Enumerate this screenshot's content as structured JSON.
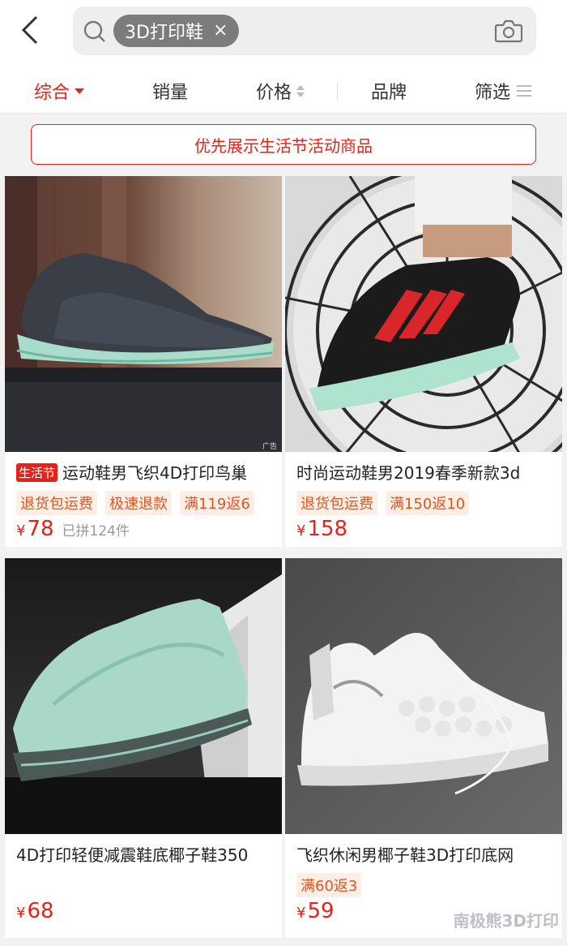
{
  "search": {
    "chip_text": "3D打印鞋",
    "chip_close": "×"
  },
  "sort": {
    "items": [
      "综合",
      "销量",
      "价格",
      "品牌",
      "筛选"
    ],
    "active": "综合"
  },
  "promo": {
    "text": "优先展示生活节活动商品"
  },
  "products": [
    {
      "badge": "生活节",
      "title": "运动鞋男飞织4D打印鸟巢",
      "tags": [
        "退货包运费",
        "极速退款",
        "满119返6"
      ],
      "currency": "¥",
      "price": "78",
      "sold": "已拼124件",
      "ad_label": "广告",
      "image": "dark-gray-knit-sneaker-teal-sole"
    },
    {
      "title": "时尚运动鞋男2019春季新款3d",
      "tags": [
        "退货包运费",
        "满150返10"
      ],
      "currency": "¥",
      "price": "158",
      "image": "black-red-sneaker-fan-background"
    },
    {
      "title": "4D打印轻便减震鞋底椰子鞋350",
      "tags": [],
      "currency": "¥",
      "price": "68",
      "image": "mint-green-knit-sneaker"
    },
    {
      "title": "飞织休闲男椰子鞋3D打印底网",
      "tags": [
        "满60返3"
      ],
      "currency": "¥",
      "price": "59",
      "image": "white-knit-sneaker"
    }
  ],
  "watermark": "南极熊3D打印",
  "colors": {
    "accent": "#e2231a",
    "tag_text": "#e0561f",
    "tag_bg": "#fdeee6"
  }
}
